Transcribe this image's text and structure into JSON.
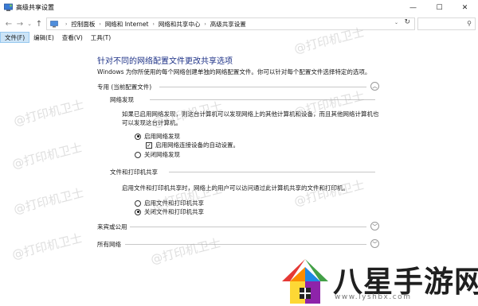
{
  "window": {
    "title": "高级共享设置",
    "minimize": "—",
    "maximize": "☐",
    "close": "✕"
  },
  "address": {
    "crumbs": [
      "控制面板",
      "网络和 Internet",
      "网络和共享中心",
      "高级共享设置"
    ],
    "search_placeholder": ""
  },
  "menu": {
    "items": [
      "文件(F)",
      "编辑(E)",
      "查看(V)",
      "工具(T)"
    ]
  },
  "main": {
    "heading": "针对不同的网络配置文件更改共享选项",
    "description": "Windows 为你所使用的每个网络创建单独的网络配置文件。你可以针对每个配置文件选择特定的选项。",
    "profile_private": {
      "title": "专用 (当前配置文件)",
      "network_discovery": {
        "title": "网络发现",
        "text_line1": "如果已启用网络发现，则这台计算机可以发现网络上的其他计算机和设备，而且其他网络计算机也",
        "text_line2": "可以发现这台计算机。",
        "option_on": "启用网络发现",
        "auto_setup": "启用网络连接设备的自动设置。",
        "option_off": "关闭网络发现"
      },
      "file_printer_sharing": {
        "title": "文件和打印机共享",
        "text": "启用文件和打印机共享时，网络上的用户可以访问通过此计算机共享的文件和打印机。",
        "option_on": "启用文件和打印机共享",
        "option_off": "关闭文件和打印机共享"
      }
    },
    "profile_guest": {
      "title": "来宾或公用"
    },
    "profile_all": {
      "title": "所有网络"
    }
  },
  "watermark": "@打印机卫士",
  "brand": {
    "name": "八星手游网",
    "url": "www.lyshbx.com"
  },
  "colors": {
    "heading": "#1e3287",
    "menu_active": "#cce4f7"
  }
}
